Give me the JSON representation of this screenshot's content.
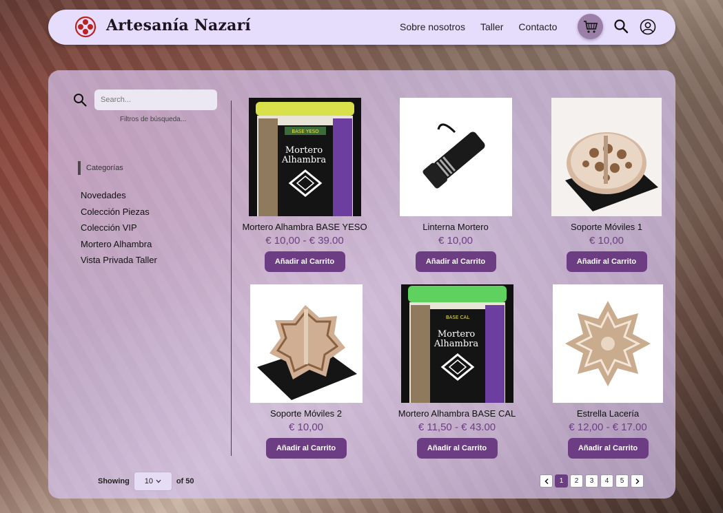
{
  "brand": {
    "name": "Artesanía Nazarí"
  },
  "nav": {
    "items": [
      "Sobre nosotros",
      "Taller",
      "Contacto"
    ]
  },
  "icons": {
    "cart": "cart-icon",
    "search": "search-icon",
    "user": "user-icon",
    "logo": "logo-icon"
  },
  "colors": {
    "accent": "#6d3d84",
    "header_bg": "#e6dcfb",
    "panel_bg": "#d6c4ee"
  },
  "sidebar": {
    "search_placeholder": "Search...",
    "filters_label": "Filtros de búsqueda...",
    "categories_title": "Categorías",
    "categories": [
      "Novedades",
      "Colección Piezas",
      "Colección VIP",
      "Mortero Alhambra",
      "Vista Privada Taller"
    ]
  },
  "products": [
    {
      "name": "Mortero Alhambra BASE YESO",
      "price": "€ 10,00 - € 39.00",
      "button": "Añadir al Carrito",
      "image": "mortero-yeso"
    },
    {
      "name": "Linterna Mortero",
      "price": "€ 10,00",
      "button": "Añadir al Carrito",
      "image": "linterna"
    },
    {
      "name": "Soporte Móviles 1",
      "price": "€ 10,00",
      "button": "Añadir al Carrito",
      "image": "soporte1"
    },
    {
      "name": "Soporte Móviles 2",
      "price": "€ 10,00",
      "button": "Añadir al Carrito",
      "image": "soporte2"
    },
    {
      "name": "Mortero Alhambra BASE CAL",
      "price": "€ 11,50 - € 43.00",
      "button": "Añadir al Carrito",
      "image": "mortero-cal"
    },
    {
      "name": "Estrella Lacería",
      "price": "€ 12,00 - € 17.00",
      "button": "Añadir al Carrito",
      "image": "estrella"
    }
  ],
  "footer": {
    "showing_label": "Showing",
    "page_size": "10",
    "of_label": "of 50",
    "pages": [
      "1",
      "2",
      "3",
      "4",
      "5"
    ],
    "current_page": "1"
  }
}
